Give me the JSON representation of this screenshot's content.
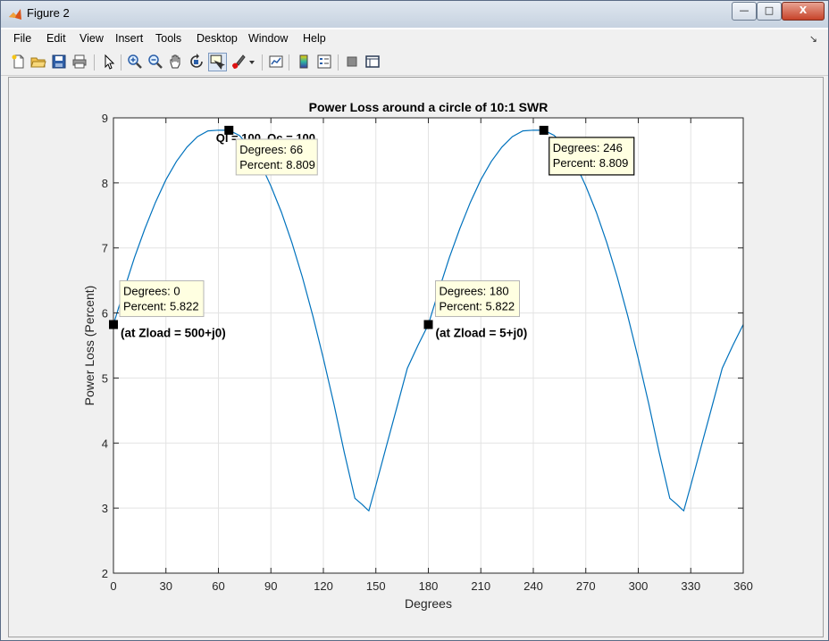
{
  "window": {
    "title": "Figure 2",
    "buttons": {
      "minimize": "—",
      "maximize": "□",
      "close": "X"
    }
  },
  "menu": [
    "File",
    "Edit",
    "View",
    "Insert",
    "Tools",
    "Desktop",
    "Window",
    "Help"
  ],
  "toolbar_icons": [
    "new-figure-icon",
    "open-file-icon",
    "save-icon",
    "print-icon",
    "pointer-icon",
    "zoom-in-icon",
    "zoom-out-icon",
    "pan-icon",
    "rotate-icon",
    "data-cursor-icon",
    "brush-icon",
    "brush-dropdown-icon",
    "link-plot-icon",
    "colorbar-icon",
    "legend-icon",
    "hide-plot-tools-icon",
    "show-plot-tools-icon"
  ],
  "chart_data": {
    "type": "line",
    "title": "Power Loss around a circle of 10:1 SWR",
    "subtitle": "Ql = 100, Qc = 100",
    "xlabel": "Degrees",
    "ylabel": "Power Loss (Percent)",
    "xlim": [
      0,
      360
    ],
    "ylim": [
      2,
      9
    ],
    "xticks": [
      0,
      30,
      60,
      90,
      120,
      150,
      180,
      210,
      240,
      270,
      300,
      330,
      360
    ],
    "yticks": [
      2,
      3,
      4,
      5,
      6,
      7,
      8,
      9
    ],
    "grid": true,
    "line_color": "#0072BD",
    "series": [
      {
        "x": [
          0,
          6,
          12,
          18,
          24,
          30,
          36,
          42,
          48,
          54,
          60,
          66,
          72,
          78,
          84,
          90,
          96,
          102,
          108,
          114,
          120,
          126,
          132,
          138,
          142,
          145,
          146,
          150,
          156,
          162,
          168,
          174,
          180,
          186,
          192,
          198,
          204,
          210,
          216,
          222,
          228,
          234,
          240,
          246,
          252,
          258,
          264,
          270,
          276,
          282,
          288,
          294,
          300,
          306,
          312,
          318,
          322,
          325,
          326,
          330,
          336,
          342,
          348,
          354,
          360
        ],
        "y": [
          5.822,
          6.35,
          6.85,
          7.3,
          7.7,
          8.05,
          8.33,
          8.55,
          8.71,
          8.8,
          8.81,
          8.809,
          8.73,
          8.55,
          8.3,
          7.95,
          7.55,
          7.08,
          6.55,
          5.95,
          5.3,
          4.6,
          3.85,
          3.15,
          3.06,
          2.98,
          2.96,
          3.35,
          3.95,
          4.55,
          5.15,
          5.5,
          5.822,
          6.35,
          6.85,
          7.3,
          7.7,
          8.05,
          8.33,
          8.55,
          8.71,
          8.8,
          8.81,
          8.809,
          8.73,
          8.55,
          8.3,
          7.95,
          7.55,
          7.08,
          6.55,
          5.95,
          5.3,
          4.6,
          3.85,
          3.15,
          3.06,
          2.98,
          2.96,
          3.35,
          3.95,
          4.55,
          5.15,
          5.5,
          5.822
        ]
      }
    ],
    "datatips": [
      {
        "x": 0,
        "y": 5.822,
        "line1": "Degrees: 0",
        "line2": "Percent: 5.822",
        "selected": false
      },
      {
        "x": 66,
        "y": 8.809,
        "line1": "Degrees: 66",
        "line2": "Percent: 8.809",
        "selected": false
      },
      {
        "x": 180,
        "y": 5.822,
        "line1": "Degrees: 180",
        "line2": "Percent: 5.822",
        "selected": false
      },
      {
        "x": 246,
        "y": 8.809,
        "line1": "Degrees: 246",
        "line2": "Percent: 8.809",
        "selected": true
      }
    ],
    "annotations": [
      {
        "text": "(at Zload = 500+j0)",
        "x": 0
      },
      {
        "text": "(at Zload = 5+j0)",
        "x": 180
      }
    ]
  }
}
